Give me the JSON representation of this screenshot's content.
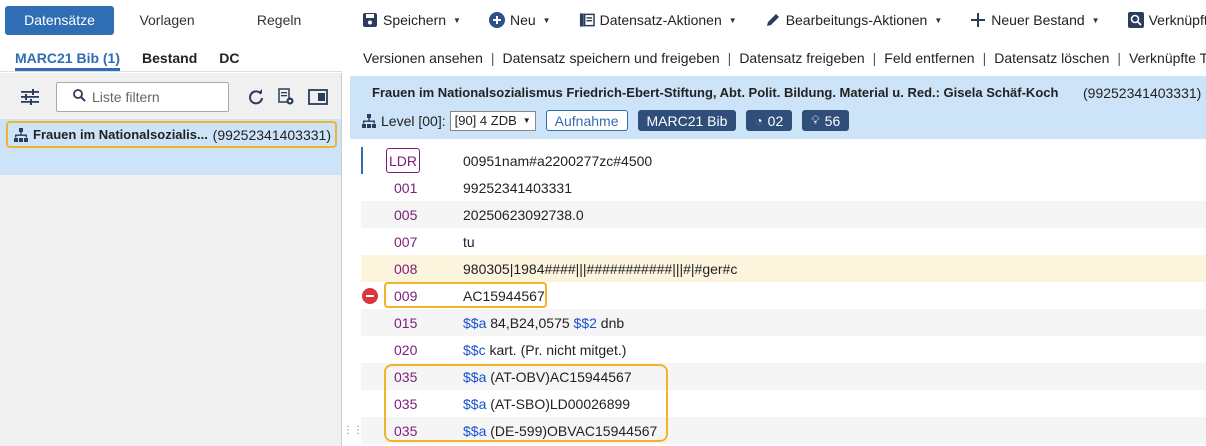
{
  "top_tabs": [
    "Datensätze",
    "Vorlagen",
    "Regeln"
  ],
  "toolbar": {
    "save": "Speichern",
    "new": "Neu",
    "record_actions": "Datensatz-Aktionen",
    "edit_actions": "Bearbeitungs-Aktionen",
    "new_holding": "Neuer Bestand",
    "linked": "Verknüpfte D"
  },
  "sub_tabs": [
    "MARC21 Bib (1)",
    "Bestand",
    "DC"
  ],
  "actions": [
    "Versionen ansehen",
    "Datensatz speichern und freigeben",
    "Datensatz freigeben",
    "Feld entfernen",
    "Datensatz löschen",
    "Verknüpfte Tite"
  ],
  "filter": {
    "placeholder": "Liste filtern"
  },
  "list_item": {
    "title": "Frauen im Nationalsozialis...",
    "id": "(99252341403331)"
  },
  "record": {
    "title": "Frauen im Nationalsozialismus Friedrich-Ebert-Stiftung, Abt. Polit. Bildung. Material u. Red.: Gisela Schäf-Koch",
    "id": "(99252341403331)",
    "level_label": "Level [00]:",
    "level_value": "[90] 4 ZDB",
    "badge_aufnahme": "Aufnahme",
    "badge_marc": "MARC21 Bib",
    "badge_gauge": "02",
    "badge_bulb": "56"
  },
  "fields": [
    {
      "tag": "LDR",
      "value": "00951nam#a2200277zc#4500"
    },
    {
      "tag": "001",
      "value": "99252341403331"
    },
    {
      "tag": "005",
      "value": "20250623092738.0"
    },
    {
      "tag": "007",
      "value": "tu"
    },
    {
      "tag": "008",
      "value": "980305|1984####|||###########|||#|#ger#c"
    },
    {
      "tag": "009",
      "value": "AC15944567"
    },
    {
      "tag": "015",
      "sub1": "$$a",
      "v1": " 84,B24,0575 ",
      "sub2": "$$2",
      "v2": " dnb"
    },
    {
      "tag": "020",
      "sub1": "$$c",
      "v1": " kart. (Pr. nicht mitget.)"
    },
    {
      "tag": "035",
      "sub1": "$$a",
      "v1": " (AT-OBV)AC15944567"
    },
    {
      "tag": "035",
      "sub1": "$$a",
      "v1": " (AT-SBO)LD00026899"
    },
    {
      "tag": "035",
      "sub1": "$$a",
      "v1": " (DE-599)OBVAC15944567"
    }
  ],
  "colors": {
    "accent": "#2f6db5",
    "highlight": "#f0b429",
    "tag": "#7b1e7a",
    "subfield": "#1a4fd1",
    "error": "#d9363e"
  }
}
